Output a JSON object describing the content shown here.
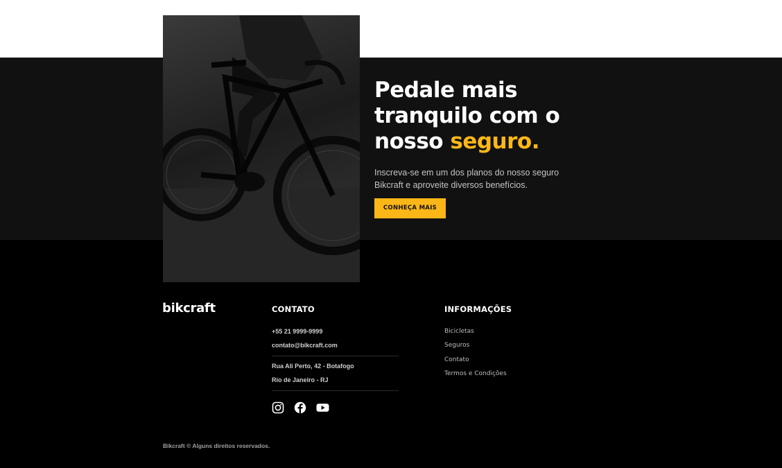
{
  "insurance": {
    "headline_line1": "Pedale mais",
    "headline_line2": "tranquilo com o",
    "headline_line3_prefix": "nosso ",
    "headline_accent": "seguro.",
    "lead": "Inscreva-se em um dos planos do nosso seguro Bikcraft e aproveite diversos benefícios.",
    "cta_label": "CONHEÇA MAIS",
    "accent_color": "#fbb718",
    "photo_icon": "cyclist-photo"
  },
  "footer": {
    "logo": "bikcraft",
    "contact": {
      "title": "CONTATO",
      "phone": "+55 21 9999-9999",
      "email": "contato@bikcraft.com",
      "street": "Rua Ali Perto, 42 - Botafogo",
      "city": "Rio de Janeiro - RJ"
    },
    "social_icons": [
      "instagram-icon",
      "facebook-icon",
      "youtube-icon"
    ],
    "info": {
      "title": "INFORMAÇÕES",
      "links": [
        "Bicicletas",
        "Seguros",
        "Contato",
        "Termos e Condições"
      ]
    },
    "copyright": "Bikcraft © Alguns direitos reservados."
  }
}
